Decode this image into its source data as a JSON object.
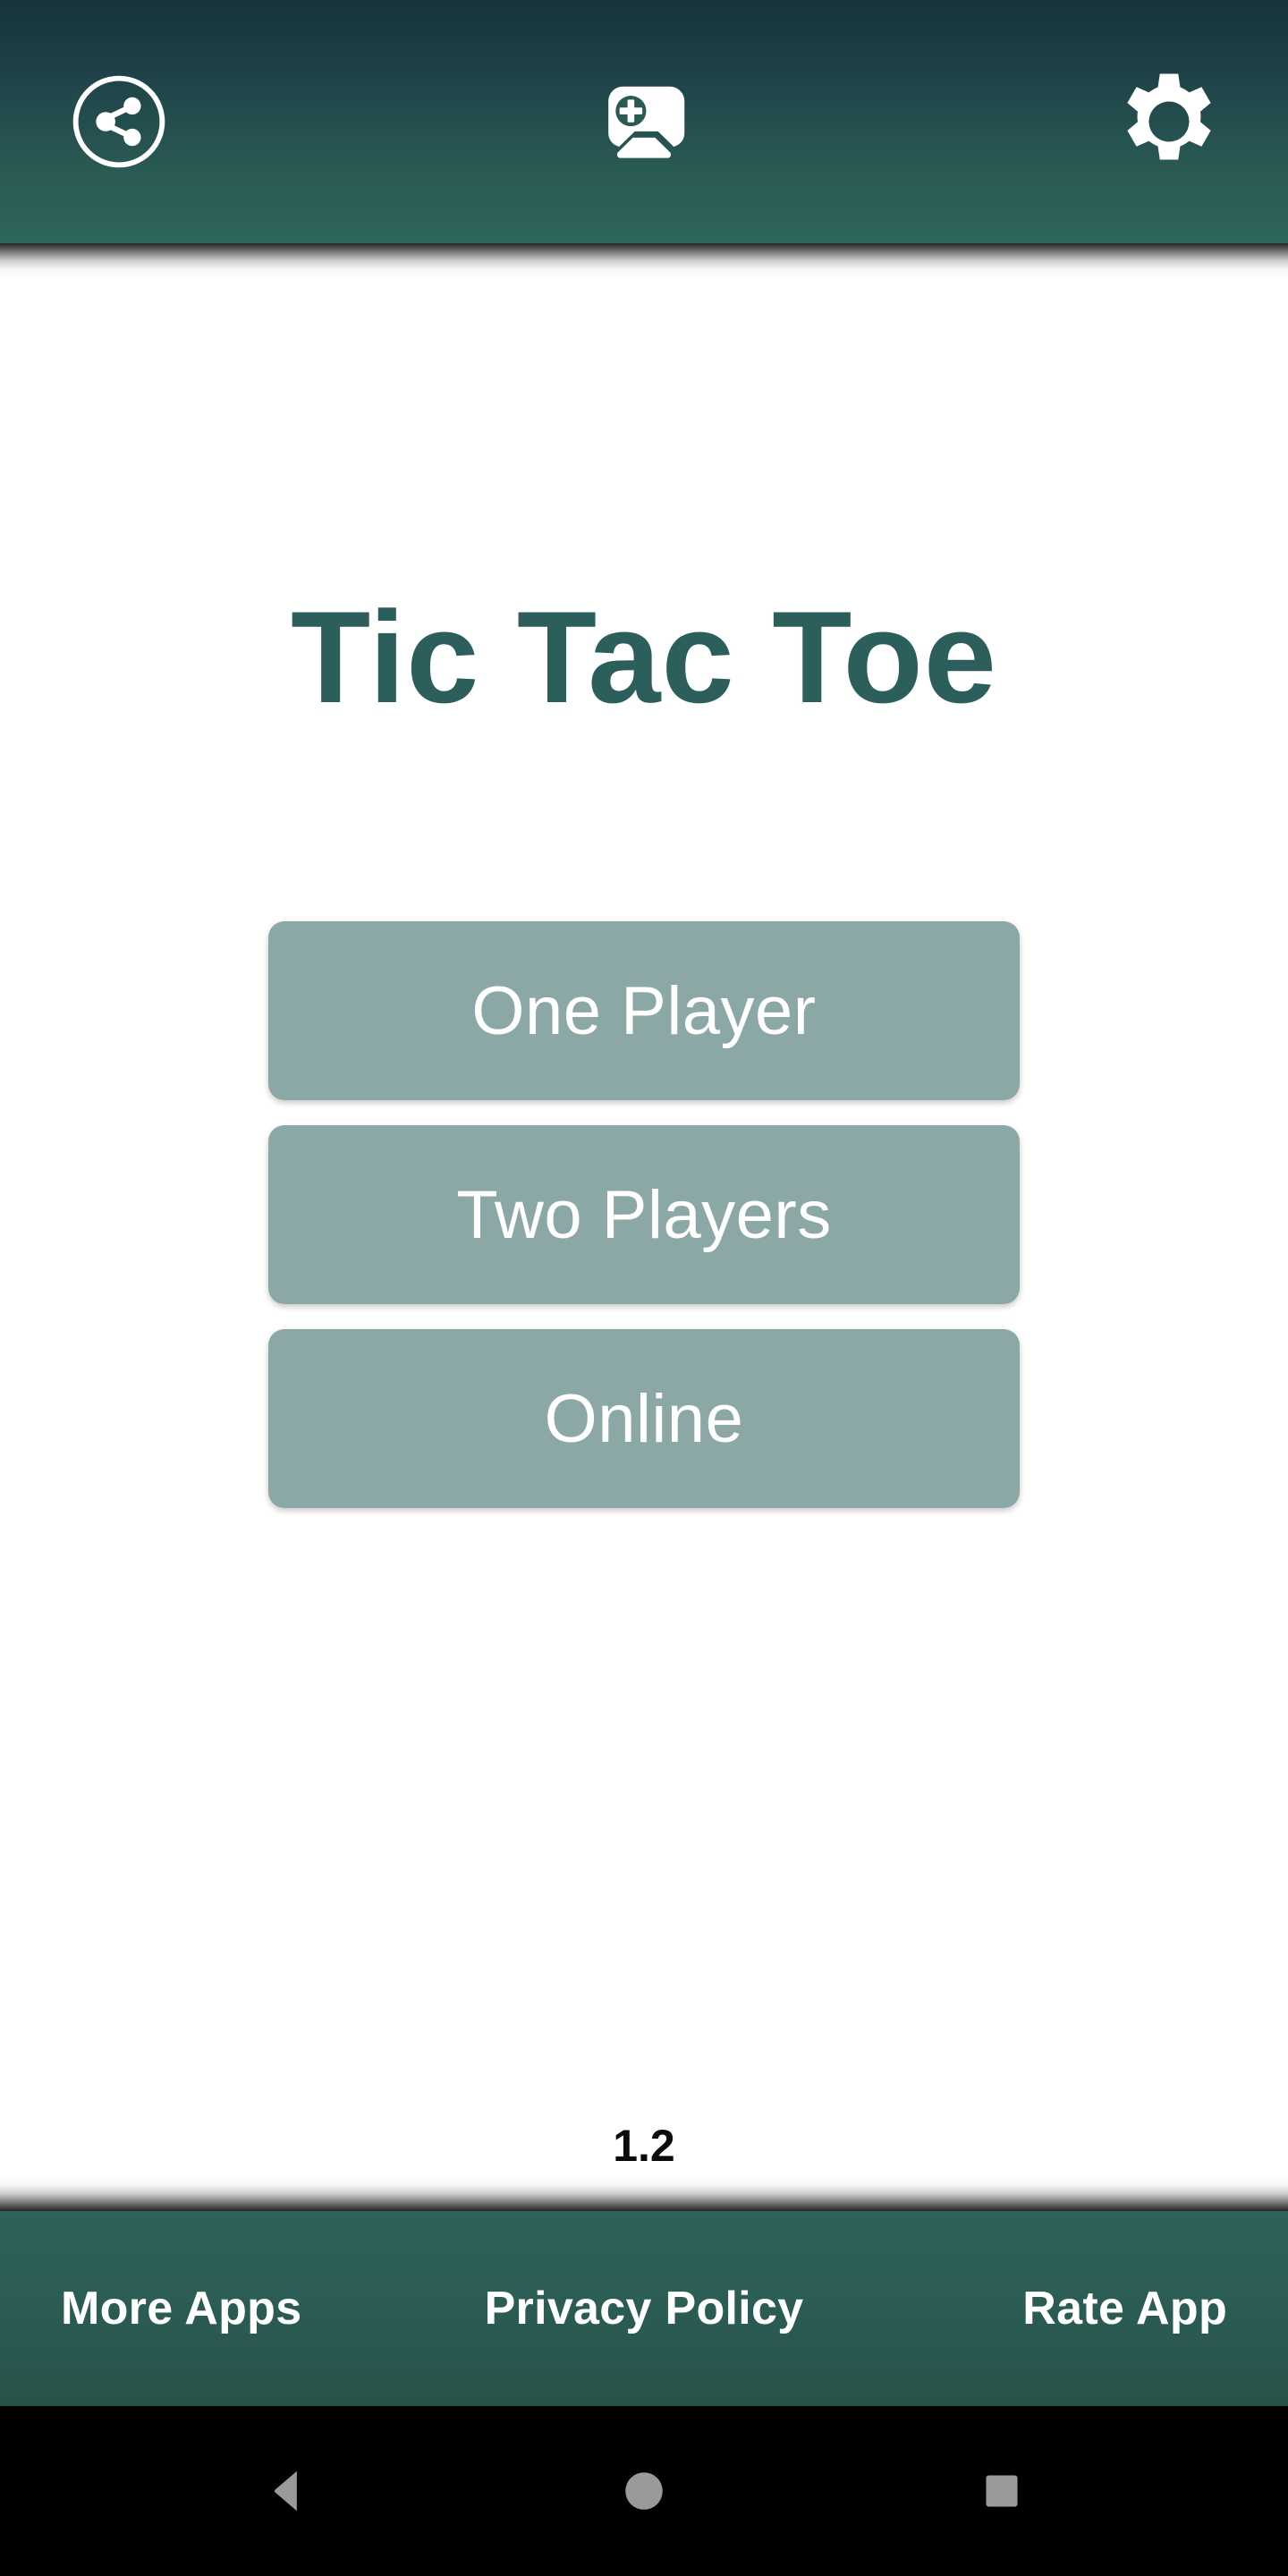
{
  "app": {
    "title": "Tic Tac Toe",
    "version": "1.2",
    "accent_dark": "#2c5f5c",
    "appbar_gradient_top": "#16333b",
    "appbar_gradient_bottom": "#2d665a",
    "button_color": "#8ba8a6",
    "button_text_color": "#ffffff",
    "background": "#ffffff"
  },
  "appbar": {
    "share_icon": "share-circle-icon",
    "games_icon": "gamepad-icon",
    "settings_icon": "gear-icon"
  },
  "menu": {
    "buttons": [
      {
        "label": "One Player"
      },
      {
        "label": "Two Players"
      },
      {
        "label": "Online"
      }
    ]
  },
  "footer": {
    "links": [
      {
        "label": "More Apps"
      },
      {
        "label": "Privacy Policy"
      },
      {
        "label": "Rate App"
      }
    ]
  },
  "system_nav": {
    "back": "back-triangle-icon",
    "home": "home-circle-icon",
    "recents": "recents-square-icon",
    "icon_color": "#9a9a9a",
    "background": "#000000"
  }
}
